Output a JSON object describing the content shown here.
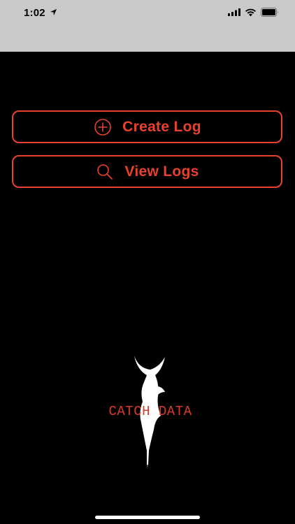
{
  "status_bar": {
    "time": "1:02"
  },
  "icons": {
    "location": "location-arrow-icon",
    "signal": "cellular-signal-icon",
    "wifi": "wifi-icon",
    "battery": "battery-icon",
    "create": "plus-circle-icon",
    "view": "magnifier-icon"
  },
  "actions": {
    "create_label": "Create Log",
    "view_label": "View Logs"
  },
  "logo": {
    "text": "CATCH DATA"
  },
  "colors": {
    "accent": "#e8412c",
    "background": "#000000",
    "status_bar": "#c9c9c9"
  }
}
